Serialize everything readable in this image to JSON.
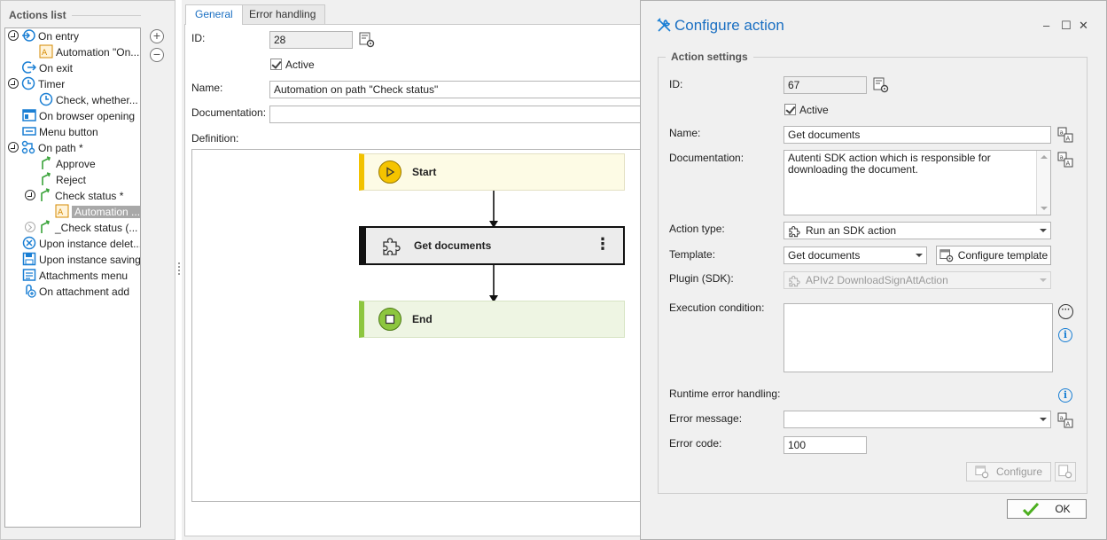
{
  "actions_list": {
    "title": "Actions list",
    "items": [
      {
        "label": "On entry"
      },
      {
        "label": "Automation \"On..."
      },
      {
        "label": "On exit"
      },
      {
        "label": "Timer"
      },
      {
        "label": "Check, whether..."
      },
      {
        "label": "On browser opening"
      },
      {
        "label": "Menu button"
      },
      {
        "label": "On path *"
      },
      {
        "label": "Approve"
      },
      {
        "label": "Reject"
      },
      {
        "label": "Check status *"
      },
      {
        "label": "Automation ..."
      },
      {
        "label": "_Check status (..."
      },
      {
        "label": "Upon instance delet..."
      },
      {
        "label": "Upon instance saving"
      },
      {
        "label": "Attachments menu"
      },
      {
        "label": "On attachment add"
      }
    ],
    "add_symbol": "+",
    "remove_symbol": "−"
  },
  "center": {
    "tabs": [
      {
        "label": "General"
      },
      {
        "label": "Error handling"
      }
    ],
    "id_label": "ID:",
    "id_value": "28",
    "active_label": "Active",
    "name_label": "Name:",
    "name_value": "Automation on path \"Check status\"",
    "documentation_label": "Documentation:",
    "documentation_value": "",
    "definition_label": "Definition:",
    "flow": {
      "start": "Start",
      "action": "Get documents",
      "end": "End",
      "menu_symbol": "⋮"
    }
  },
  "dialog": {
    "title": "Configure action",
    "group_title": "Action settings",
    "id_label": "ID:",
    "id_value": "67",
    "active_label": "Active",
    "name_label": "Name:",
    "name_value": "Get documents",
    "documentation_label": "Documentation:",
    "documentation_value": "Autenti SDK action which is responsible for downloading the document.",
    "action_type_label": "Action type:",
    "action_type_value": "Run an SDK action",
    "template_label": "Template:",
    "template_value": "Get documents",
    "configure_template_label": "Configure template",
    "plugin_label": "Plugin (SDK):",
    "plugin_value": "APIv2 DownloadSignAttAction",
    "execution_condition_label": "Execution condition:",
    "execution_condition_value": "",
    "runtime_error_label": "Runtime error handling:",
    "error_message_label": "Error message:",
    "error_message_value": "",
    "error_code_label": "Error code:",
    "error_code_value": "100",
    "configure_label": "Configure",
    "ok_label": "OK",
    "more_symbol": "···",
    "info_symbol": "i",
    "minimize_symbol": "–",
    "maximize_symbol": "☐",
    "close_symbol": "✕"
  },
  "colors": {
    "accent": "#1a6fc2",
    "start_bar": "#f2c200",
    "end_bar": "#8dc63f",
    "action_bar": "#111111"
  }
}
